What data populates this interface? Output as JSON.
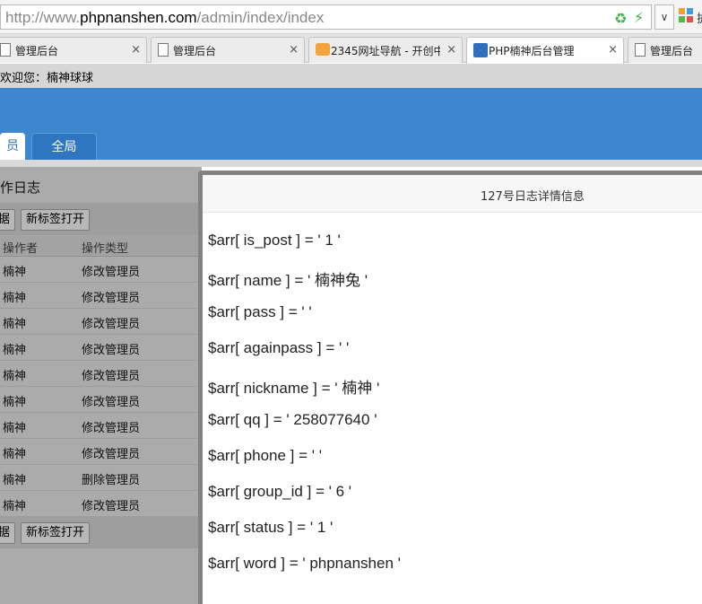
{
  "browser": {
    "url_prefix": "http://www.",
    "url_domain": "phpnanshen.com",
    "url_path": "/admin/index/index",
    "dropdown_glyph": "∨",
    "apps_label": "扩",
    "tabs": [
      {
        "label": "管理后台",
        "icon": "page-icon"
      },
      {
        "label": "管理后台",
        "icon": "page-icon"
      },
      {
        "label": "2345网址导航 - 开创中",
        "icon": "2345-logo-icon"
      },
      {
        "label": "PHP楠神后台管理",
        "icon": "php-logo-icon"
      },
      {
        "label": "管理后台",
        "icon": "page-icon"
      }
    ],
    "close_glyph": "×"
  },
  "app": {
    "welcome": "欢迎您：楠神球球",
    "nav_tabs": [
      "员",
      "全局"
    ],
    "section_title": "作日志",
    "buttons_top": [
      "据",
      "新标签打开"
    ],
    "buttons_bottom": [
      "据",
      "新标签打开"
    ],
    "table": {
      "headers": [
        "操作者",
        "操作类型"
      ],
      "rows": [
        [
          "楠神",
          "修改管理员"
        ],
        [
          "楠神",
          "修改管理员"
        ],
        [
          "楠神",
          "修改管理员"
        ],
        [
          "楠神",
          "修改管理员"
        ],
        [
          "楠神",
          "修改管理员"
        ],
        [
          "楠神",
          "修改管理员"
        ],
        [
          "楠神",
          "修改管理员"
        ],
        [
          "楠神",
          "修改管理员"
        ],
        [
          "楠神",
          "删除管理员"
        ],
        [
          "楠神",
          "修改管理员"
        ]
      ]
    }
  },
  "modal": {
    "title": "127号日志详情信息",
    "fields": [
      "$arr[ is_post ] = ' 1 '",
      "$arr[ name ] = ' 楠神兔 '",
      "$arr[ pass ] = ' '",
      "$arr[ againpass ] = ' '",
      "$arr[ nickname ] = ' 楠神 '",
      "$arr[ qq ] = ' 258077640 '",
      "$arr[ phone ] = ' '",
      "$arr[ group_id ] = ' 6 '",
      "$arr[ status ] = ' 1 '",
      "$arr[ word ] = ' phpnanshen '"
    ]
  },
  "colors": {
    "banner": "#3c87cd",
    "overlay_gray": "#ababab",
    "modal_border": "#828282"
  }
}
